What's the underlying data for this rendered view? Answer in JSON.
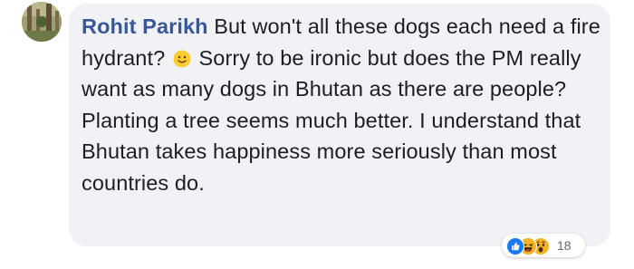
{
  "comment": {
    "author": "Rohit Parikh",
    "text_before_emoji": " But won't all these dogs each need a fire hydrant? ",
    "emoji": "slightly-smiling-face",
    "text_after_emoji": " Sorry to be ironic but does the PM really want as many dogs in Bhutan as there are people? Planting a tree seems much better. I understand that Bhutan takes happiness more seriously than most countries do."
  },
  "reactions": {
    "icons": [
      "like-icon",
      "haha-icon",
      "wow-icon"
    ],
    "count": "18"
  },
  "colors": {
    "author": "#385898",
    "bubble": "#f0f2f5",
    "text": "#1c1e21",
    "like": "#1877f2",
    "emoji_yellow": "#f7b125",
    "count": "#65676b"
  }
}
